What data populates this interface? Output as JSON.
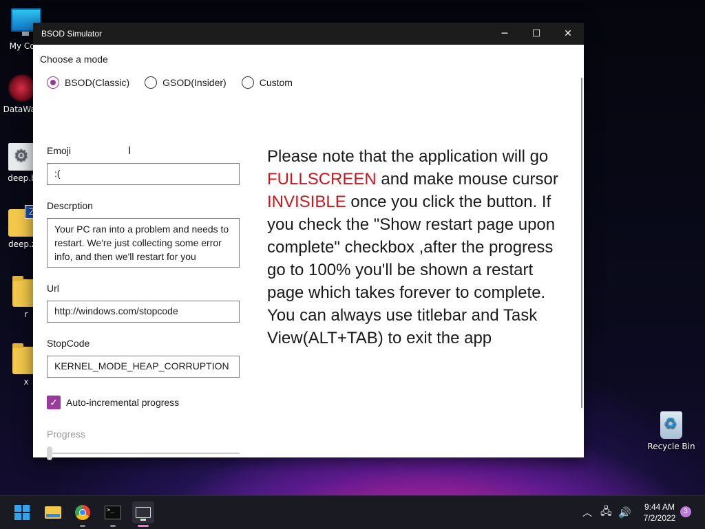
{
  "desktop": {
    "icons": [
      {
        "label": "My Com",
        "icon": "computer-icon"
      },
      {
        "label": "DataWag",
        "icon": "app-icon"
      },
      {
        "label": "deep.b",
        "icon": "settings-file-icon"
      },
      {
        "label": "deep.z",
        "icon": "zip-folder-icon"
      },
      {
        "label": "r",
        "icon": "folder-icon"
      },
      {
        "label": "x",
        "icon": "folder-icon"
      }
    ],
    "recycle_bin": {
      "label": "Recycle Bin",
      "icon": "recycle-bin-icon"
    }
  },
  "window": {
    "title": "BSOD Simulator",
    "controls": {
      "minimize": "─",
      "maximize": "☐",
      "close": "✕"
    }
  },
  "form": {
    "mode_label": "Choose a mode",
    "modes": [
      {
        "label": "BSOD(Classic)",
        "selected": true
      },
      {
        "label": "GSOD(Insider)",
        "selected": false
      },
      {
        "label": "Custom",
        "selected": false
      }
    ],
    "emoji": {
      "label": "Emoji",
      "value": ":("
    },
    "description": {
      "label": "Descrption",
      "value": "Your PC ran into a problem and needs to restart. We're just collecting some error info, and then we'll restart for you"
    },
    "url": {
      "label": "Url",
      "value": "http://windows.com/stopcode"
    },
    "stopcode": {
      "label": "StopCode",
      "value": "KERNEL_MODE_HEAP_CORRUPTION"
    },
    "auto_progress": {
      "label": "Auto-incremental progress",
      "checked": true
    },
    "progress": {
      "label": "Progress",
      "value": 0
    }
  },
  "notice": {
    "part1": "Please note that the application will go ",
    "highlight1": "FULLSCREEN",
    "part2": " and make mouse cursor ",
    "highlight2": "INVISIBLE",
    "part3": " once you click the button. If you check the \"Show restart page upon complete\" checkbox ,after the progress go to 100% you'll be shown a restart page which takes forever to complete. You can always use titlebar and Task View(ALT+TAB) to exit the app",
    "highlight_color": "#c9171e"
  },
  "taskbar": {
    "apps": [
      "start-icon",
      "file-explorer-icon",
      "chrome-icon",
      "terminal-icon",
      "bsod-simulator-icon"
    ],
    "time": "9:44 AM",
    "date": "7/2/2022",
    "notification_count": "3"
  },
  "colors": {
    "accent": "#9a3a9c",
    "titlebar": "#1c1c1c",
    "taskbar": "#1a1a22"
  }
}
